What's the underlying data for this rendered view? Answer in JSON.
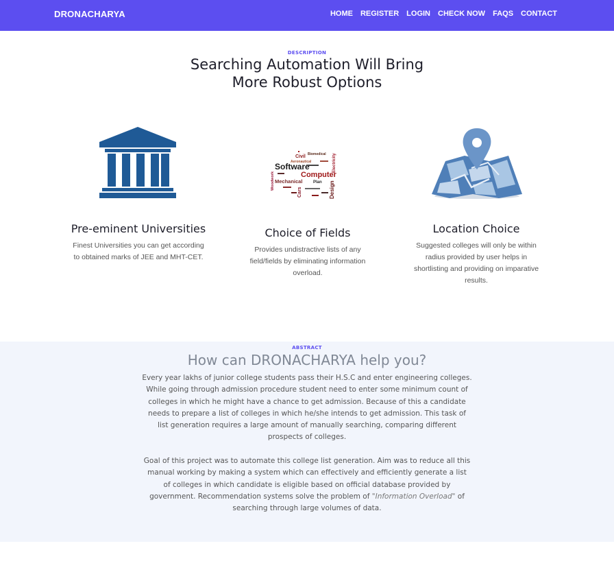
{
  "nav": {
    "brand": "DRONACHARYA",
    "links": [
      "HOME",
      "REGISTER",
      "LOGIN",
      "CHECK NOW",
      "FAQS",
      "CONTACT"
    ]
  },
  "description": {
    "eyebrow": "DESCRIPTION",
    "headline_line1": "Searching Automation Will Bring",
    "headline_line2": "More Robust Options"
  },
  "features": [
    {
      "icon": "university-icon",
      "title": "Pre-eminent Universities",
      "text_lines": [
        "Finest Universities you can get according",
        "to obtained marks of JEE and MHT-CET."
      ]
    },
    {
      "icon": "word-cloud-image",
      "title": "Choice of Fields",
      "text_lines": [
        "Provides undistractive lists of any",
        "field/fields by eliminating information",
        "overload."
      ],
      "cloud_words": [
        "Software",
        "Computer",
        "Mechanical",
        "Civil",
        "Electricity",
        "Design",
        "Aeronautical",
        "Plan",
        "Biomedical",
        "Cars",
        "Woodwork"
      ]
    },
    {
      "icon": "map-location-icon",
      "title": "Location Choice",
      "text_lines": [
        "Suggested colleges will only be within",
        "radius provided by user helps in",
        "shortlisting and providing on imparative",
        "results."
      ]
    }
  ],
  "abstract": {
    "eyebrow": "ABSTRACT",
    "title": "How can DRONACHARYA help you?",
    "para1_lines": [
      "Every year lakhs of junior college students pass their H.S.C and enter engineering colleges.",
      "While going through admission procedure student need to enter some minimum count of",
      "colleges in which he might have a chance to get admission. Because of this a candidate",
      "needs to prepare a list of colleges in which he/she intends to get admission. This task of",
      "list generation requires a large amount of manually searching, comparing different",
      "prospects of colleges."
    ],
    "para2_lines": [
      "Goal of this project was to automate this college list generation. Aim was to reduce all this",
      "manual working by making a system which can effectively and efficiently generate a list",
      "of colleges in which candidate is eligible based on official database provided by"
    ],
    "para2_line4_before": "government. Recommendation systems solve the problem of ",
    "para2_line4_em": "\"Information Overload\"",
    "para2_line4_after": " of",
    "para2_line5": "searching through large volumes of data."
  },
  "colors": {
    "accent": "#5c4ef0",
    "university_blue": "#1f5a96",
    "abstract_bg": "#f2f5fc"
  }
}
